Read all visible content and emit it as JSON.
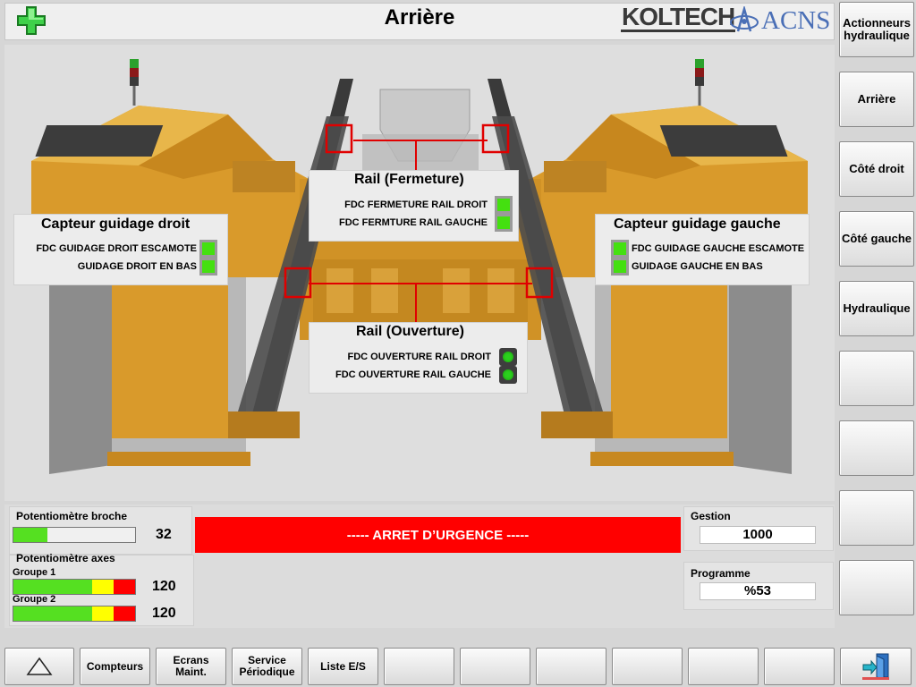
{
  "header": {
    "title": "Arrière",
    "logo_koltech": "KOLTECH",
    "logo_acns": "ACNS"
  },
  "side_buttons": [
    "Actionneurs hydraulique",
    "Arrière",
    "Côté droit",
    "Côté gauche",
    "Hydraulique",
    "",
    "",
    "",
    ""
  ],
  "panels": {
    "capteur_droit": {
      "title": "Capteur guidage droit",
      "signals": [
        "FDC GUIDAGE DROIT ESCAMOTE",
        "GUIDAGE DROIT EN BAS"
      ]
    },
    "rail_fermeture": {
      "title": "Rail (Fermeture)",
      "signals": [
        "FDC FERMETURE RAIL DROIT",
        "FDC FERMTURE RAIL GAUCHE"
      ]
    },
    "capteur_gauche": {
      "title": "Capteur guidage gauche",
      "signals": [
        "FDC GUIDAGE GAUCHE ESCAMOTE",
        "GUIDAGE GAUCHE EN BAS"
      ]
    },
    "rail_ouverture": {
      "title": "Rail (Ouverture)",
      "signals": [
        "FDC OUVERTURE RAIL DROIT",
        "FDC OUVERTURE RAIL GAUCHE"
      ]
    }
  },
  "status": {
    "pot_broche_label": "Potentiomètre broche",
    "pot_broche_value": "32",
    "pot_broche_fill": 0.28,
    "pot_axes_label": "Potentiomètre axes",
    "groupe1_label": "Groupe 1",
    "groupe1_value": "120",
    "groupe2_label": "Groupe 2",
    "groupe2_value": "120",
    "estop_text": "----- ARRET D’URGENCE -----",
    "gestion_label": "Gestion",
    "gestion_value": "1000",
    "programme_label": "Programme",
    "programme_value": "%53"
  },
  "bottom_buttons": [
    "",
    "Compteurs",
    "Ecrans Maint.",
    "Service Périodique",
    "Liste E/S",
    "",
    "",
    "",
    "",
    "",
    ""
  ],
  "colors": {
    "estop": "#ff0000",
    "led_green": "#44e010",
    "machine_yellow": "#d99a2b",
    "highlight_red": "#e00000"
  },
  "icons": {
    "plus": "plus-icon",
    "up": "up-triangle-icon",
    "exit": "exit-door-icon"
  }
}
